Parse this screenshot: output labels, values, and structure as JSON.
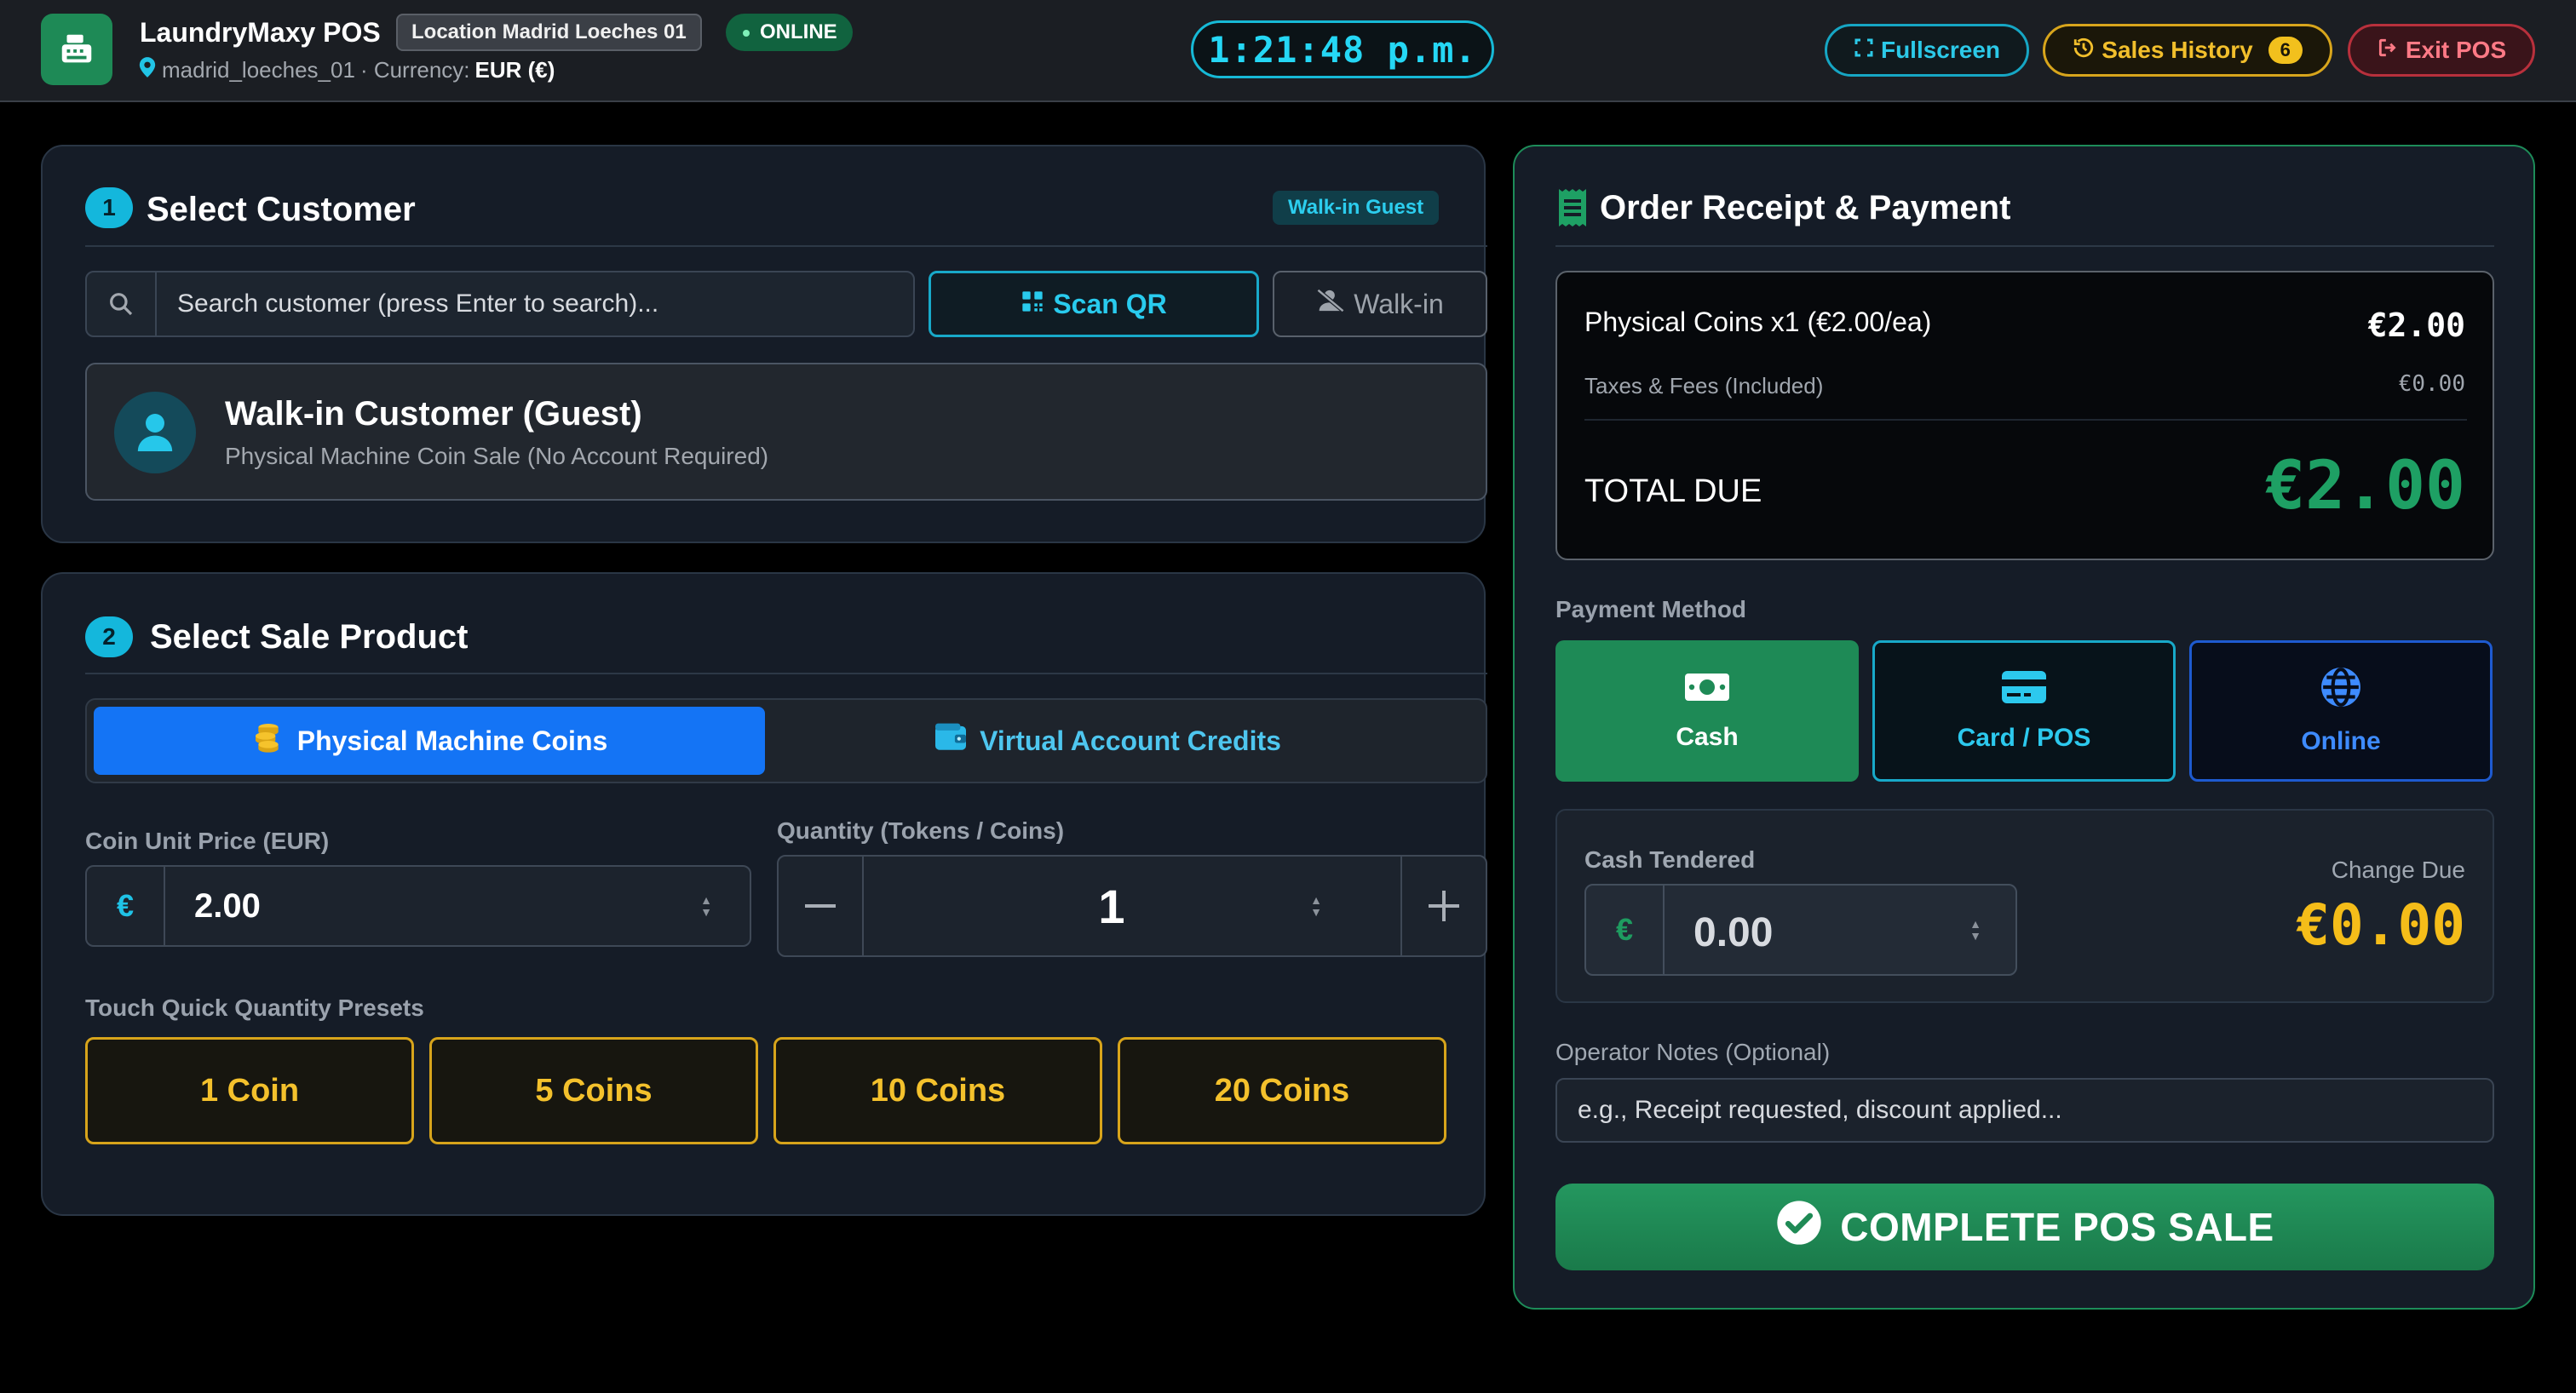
{
  "header": {
    "app_name": "LaundryMaxy POS",
    "location_badge": "Location Madrid Loeches 01",
    "status": "ONLINE",
    "location_id": "madrid_loeches_01",
    "currency_label": "· Currency:",
    "currency_value": "EUR (€)",
    "clock": "1:21:48 p.m.",
    "fullscreen_label": "Fullscreen",
    "sales_history_label": "Sales History",
    "sales_history_count": "6",
    "exit_label": "Exit POS"
  },
  "customer": {
    "step": "1",
    "title": "Select Customer",
    "badge": "Walk-in Guest",
    "search_placeholder": "Search customer (press Enter to search)...",
    "scan_label": "Scan QR",
    "walkin_label": "Walk-in",
    "selected_name": "Walk-in Customer (Guest)",
    "selected_sub": "Physical Machine Coin Sale (No Account Required)"
  },
  "product": {
    "step": "2",
    "title": "Select Sale Product",
    "tabs": [
      {
        "label": "Physical Machine Coins",
        "active": true
      },
      {
        "label": "Virtual Account Credits",
        "active": false
      }
    ],
    "price_label": "Coin Unit Price (EUR)",
    "price_prefix": "€",
    "price_value": "2.00",
    "qty_label": "Quantity (Tokens / Coins)",
    "qty_value": "1",
    "presets_label": "Touch Quick Quantity Presets",
    "presets": [
      "1 Coin",
      "5 Coins",
      "10 Coins",
      "20 Coins"
    ]
  },
  "receipt": {
    "title": "Order Receipt & Payment",
    "line_item": "Physical Coins x1 (€2.00/ea)",
    "line_amount": "€2.00",
    "tax_label": "Taxes & Fees (Included)",
    "tax_amount": "€0.00",
    "total_label": "TOTAL DUE",
    "total_amount": "€2.00",
    "payment_method_label": "Payment Method",
    "methods": [
      {
        "label": "Cash",
        "active": true
      },
      {
        "label": "Card / POS",
        "active": false
      },
      {
        "label": "Online",
        "active": false
      }
    ],
    "cash_tendered_label": "Cash Tendered",
    "cash_prefix": "€",
    "cash_tendered_value": "0.00",
    "change_due_label": "Change Due",
    "change_due_value": "€0.00",
    "notes_label": "Operator Notes (Optional)",
    "notes_placeholder": "e.g., Receipt requested, discount applied...",
    "complete_label": "COMPLETE POS SALE"
  },
  "colors": {
    "accent_cyan": "#16b9d6",
    "accent_green": "#1e8a56",
    "accent_gold": "#f4c12c",
    "accent_blue": "#1474f5",
    "danger": "#b8303c"
  }
}
